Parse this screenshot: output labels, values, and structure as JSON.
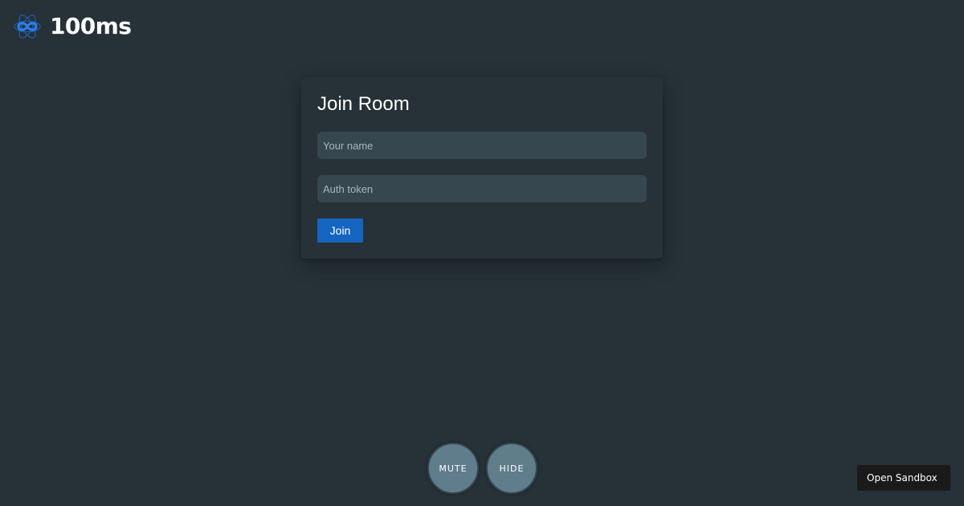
{
  "brand": {
    "name": "100ms",
    "logo_icon": "infinity-knot-icon",
    "logo_color": "#2f80ed"
  },
  "join_form": {
    "title": "Join Room",
    "name_input": {
      "value": "",
      "placeholder": "Your name"
    },
    "token_input": {
      "value": "",
      "placeholder": "Auth token"
    },
    "join_label": "Join"
  },
  "controls": {
    "mute_label": "MUTE",
    "hide_label": "HIDE"
  },
  "sandbox": {
    "label": "Open Sandbox"
  },
  "colors": {
    "background": "#263238",
    "input_background": "#37474f",
    "primary": "#1565c0",
    "control_button": "#607d8b",
    "sandbox_button": "#1a1a1a"
  }
}
